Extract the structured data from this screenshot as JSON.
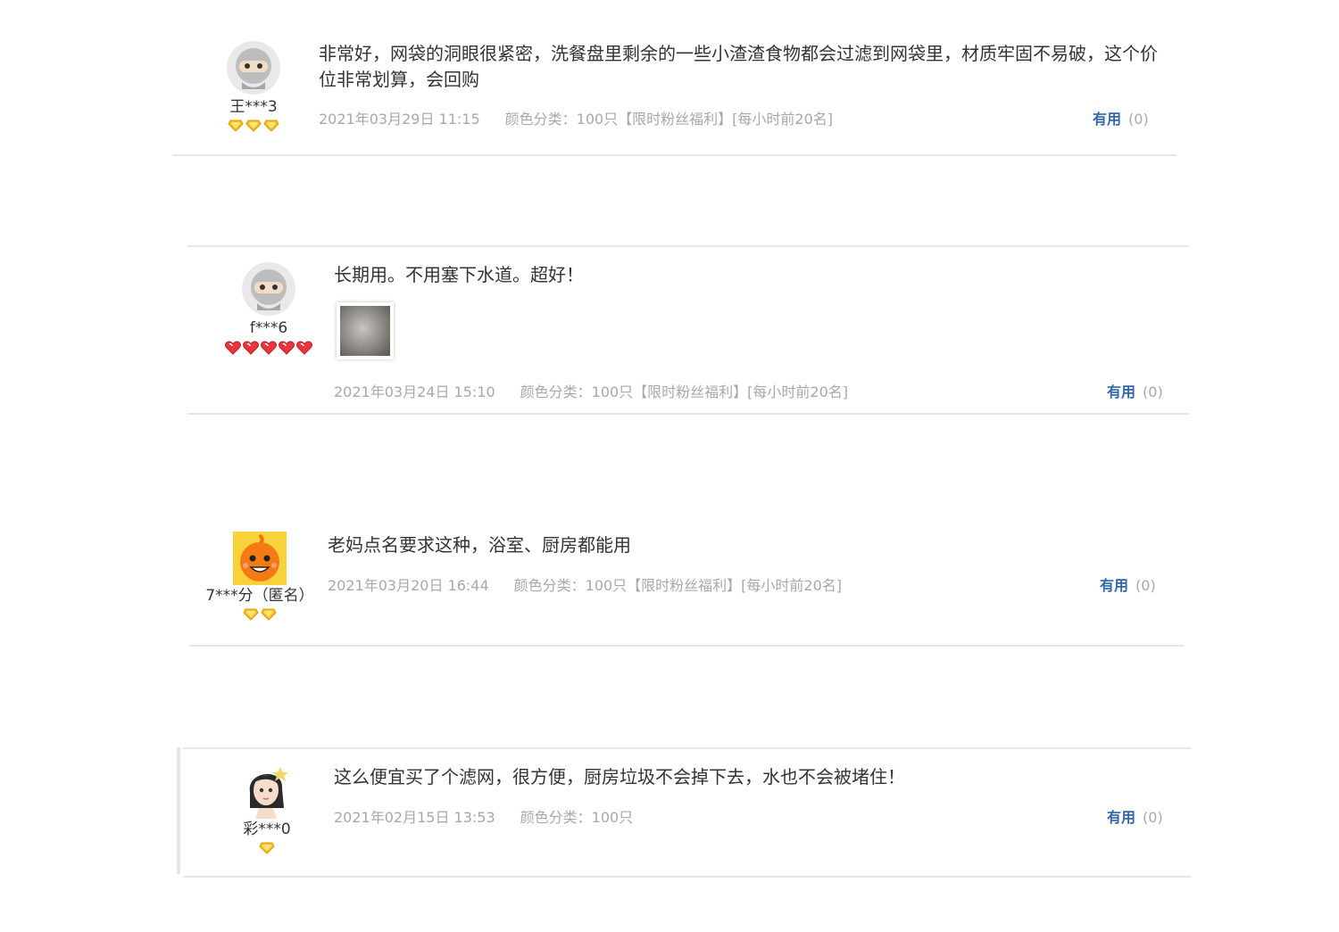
{
  "reviews": [
    {
      "username": "王***3",
      "avatar": "ninja-avatar-icon",
      "level_icon": "gold-diamond-icon",
      "level_count": 3,
      "content": "非常好，网袋的洞眼很紧密，洗餐盘里剩余的一些小渣渣食物都会过滤到网袋里，材质牢固不易破，这个价位非常划算，会回购",
      "date": "2021年03月29日 11:15",
      "sku": "颜色分类：100只【限时粉丝福利】[每小时前20名]",
      "useful_label": "有用",
      "useful_count": "(0)"
    },
    {
      "username": "f***6",
      "avatar": "ninja-avatar-icon",
      "level_icon": "red-heart-icon",
      "level_count": 5,
      "content": "长期用。不用塞下水道。超好！",
      "has_photo": true,
      "date": "2021年03月24日 15:10",
      "sku": "颜色分类：100只【限时粉丝福利】[每小时前20名]",
      "useful_label": "有用",
      "useful_count": "(0)"
    },
    {
      "username": "7***分（匿名）",
      "avatar": "taobao-mascot-avatar-icon",
      "level_icon": "gold-diamond-icon",
      "level_count": 2,
      "content": "老妈点名要求这种，浴室、厨房都能用",
      "date": "2021年03月20日 16:44",
      "sku": "颜色分类：100只【限时粉丝福利】[每小时前20名]",
      "useful_label": "有用",
      "useful_count": "(0)"
    },
    {
      "username": "彩***0",
      "avatar": "girl-avatar-icon",
      "level_icon": "gold-diamond-icon",
      "level_count": 1,
      "content": "这么便宜买了个滤网，很方便，厨房垃圾不会掉下去，水也不会被堵住！",
      "date": "2021年02月15日 13:53",
      "sku": "颜色分类：100只",
      "useful_label": "有用",
      "useful_count": "(0)"
    }
  ],
  "colors": {
    "useful_link": "#3366aa",
    "meta_text": "#a8a8a8",
    "gold_diamond": "#f6c21b",
    "red_heart": "#e8343a"
  }
}
